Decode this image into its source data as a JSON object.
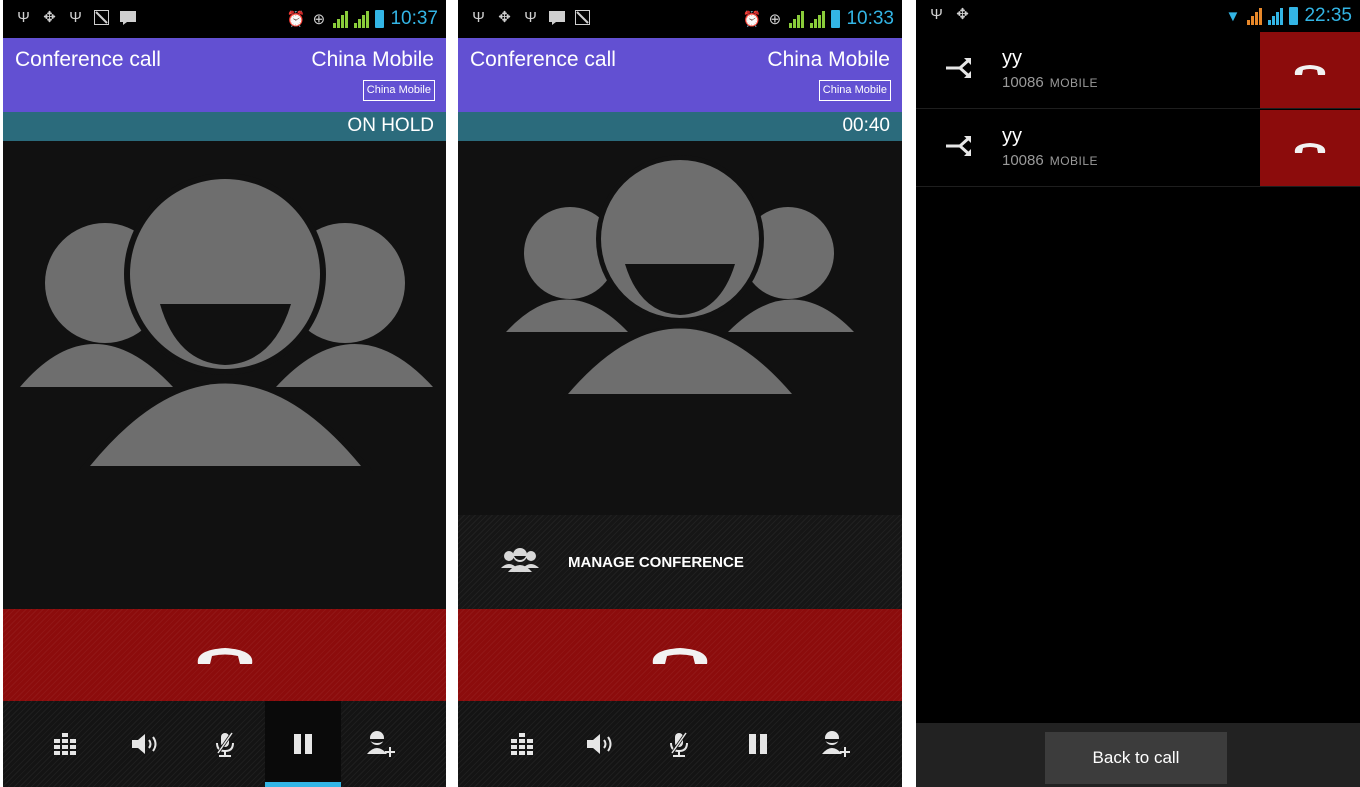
{
  "screens": [
    {
      "status": {
        "time": "10:37"
      },
      "header": {
        "title": "Conference call",
        "operator": "China Mobile",
        "badge": "China Mobile"
      },
      "subbar": "ON HOLD",
      "selected_control": "hold",
      "controls": [
        "dialpad-icon",
        "speaker-icon",
        "mute-icon",
        "hold-icon",
        "add-call-icon"
      ]
    },
    {
      "status": {
        "time": "10:33"
      },
      "header": {
        "title": "Conference call",
        "operator": "China Mobile",
        "badge": "China Mobile"
      },
      "subbar": "00:40",
      "manage_label": "MANAGE CONFERENCE",
      "controls": [
        "dialpad-icon",
        "speaker-icon",
        "mute-icon",
        "hold-icon",
        "add-call-icon"
      ]
    },
    {
      "status": {
        "time": "22:35"
      },
      "participants": [
        {
          "name": "yy",
          "number": "10086",
          "type": "MOBILE"
        },
        {
          "name": "yy",
          "number": "10086",
          "type": "MOBILE"
        }
      ],
      "back_label": "Back to call"
    }
  ],
  "colors": {
    "header_bg": "#6250d2",
    "subbar_bg": "#2b6b7c",
    "end_call_red": "#8c0c0c",
    "accent_blue": "#33b5e5",
    "avatar_gray": "#6e6e6e"
  }
}
